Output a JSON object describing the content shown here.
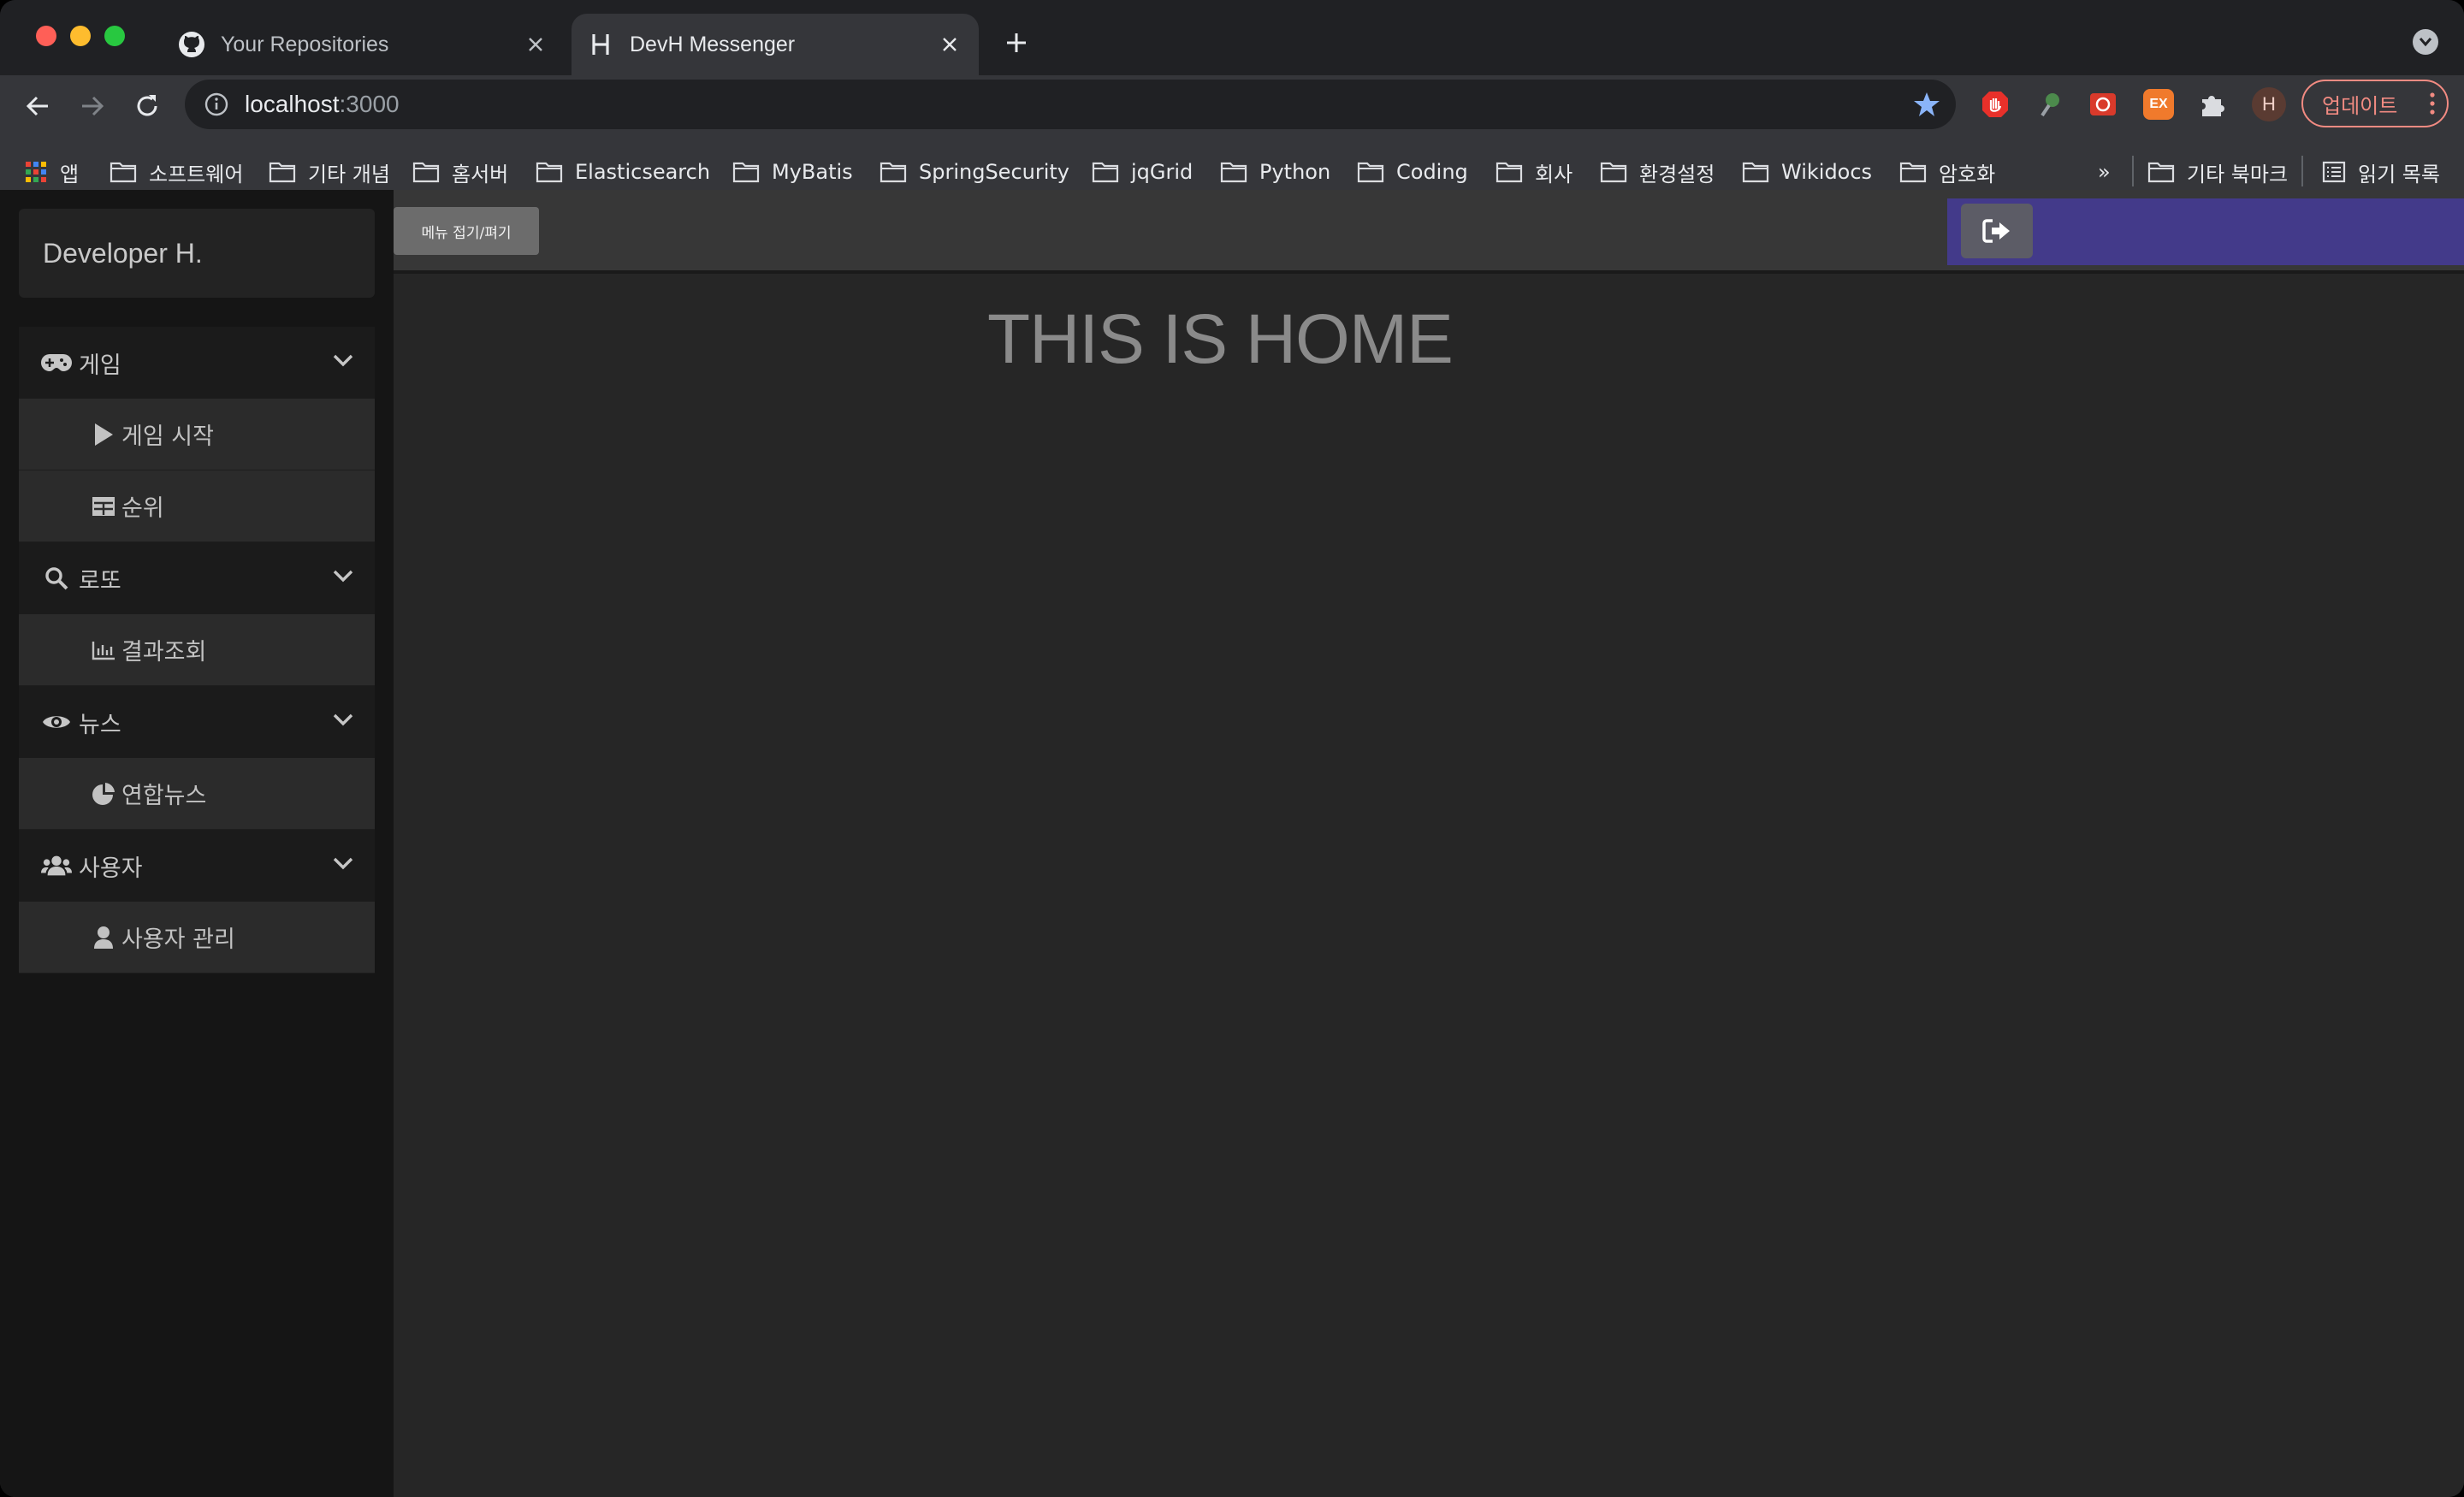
{
  "browser": {
    "tabs": [
      {
        "title": "Your Repositories",
        "icon": "github-icon",
        "active": false
      },
      {
        "title": "DevH Messenger",
        "icon": "h-favicon",
        "active": true
      }
    ],
    "address": {
      "host": "localhost",
      "port": ":3000"
    },
    "profile_initial": "H",
    "update_label": "업데이트",
    "extensions": [
      {
        "name": "adblock-icon",
        "color": "#e8302a"
      },
      {
        "name": "dark-ext-icon",
        "color": "#3c6e3c"
      },
      {
        "name": "red-ext-icon",
        "color": "#d93a2b"
      },
      {
        "name": "ex-ext-icon",
        "color": "#f07a2c",
        "text": "EX"
      },
      {
        "name": "puzzle-icon",
        "color": "#dadce0"
      }
    ],
    "bookmarks": {
      "apps": "앱",
      "items": [
        "소프트웨어",
        "기타 개념",
        "홈서버",
        "Elasticsearch",
        "MyBatis",
        "SpringSecurity",
        "jqGrid",
        "Python",
        "Coding",
        "회사",
        "환경설정",
        "Wikidocs",
        "암호화"
      ],
      "overflow": "»",
      "other": "기타 북마크",
      "reading_list": "읽기 목록"
    }
  },
  "app": {
    "brand": "Developer H.",
    "menu": [
      {
        "label": "게임",
        "icon": "gamepad-icon",
        "items": [
          {
            "label": "게임 시작",
            "icon": "play-icon"
          },
          {
            "label": "순위",
            "icon": "table-icon"
          }
        ]
      },
      {
        "label": "로또",
        "icon": "search-icon",
        "items": [
          {
            "label": "결과조회",
            "icon": "chart-bar-icon"
          }
        ]
      },
      {
        "label": "뉴스",
        "icon": "eye-icon",
        "items": [
          {
            "label": "연합뉴스",
            "icon": "pie-chart-icon"
          }
        ]
      },
      {
        "label": "사용자",
        "icon": "users-icon",
        "items": [
          {
            "label": "사용자 관리",
            "icon": "user-icon"
          }
        ]
      }
    ],
    "toggle_label": "메뉴 접기/펴기",
    "home_title": "THIS IS HOME",
    "colors": {
      "accent": "#433a8a",
      "sidebar": "#151515",
      "content": "#262626"
    }
  }
}
